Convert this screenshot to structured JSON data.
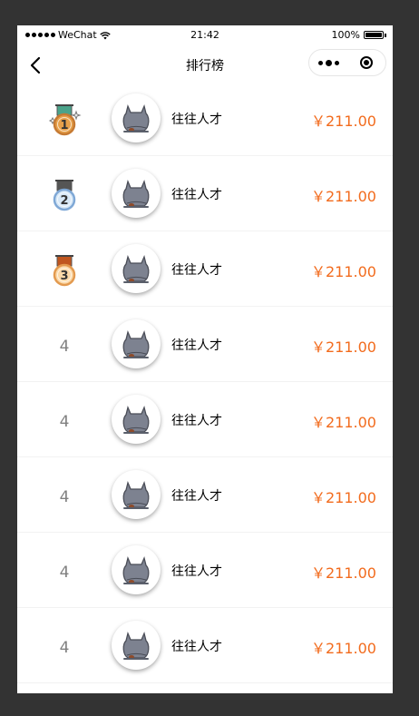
{
  "status_bar": {
    "carrier": "WeChat",
    "time": "21:42",
    "battery_text": "100%"
  },
  "nav": {
    "title": "排行榜"
  },
  "colors": {
    "amount": "#f26b1d",
    "rank_number": "#808080",
    "gold": "#e0913a",
    "silver": "#a9cdee",
    "bronze": "#f6b26b"
  },
  "icons": {
    "back": "chevron-left-icon",
    "gold": "gold-medal-icon",
    "silver": "silver-medal-icon",
    "bronze": "bronze-medal-icon",
    "avatar": "cat-avatar-icon"
  },
  "rankings": [
    {
      "rank_label": "1",
      "medal": "gold",
      "name": "往往人才",
      "amount": "￥211.00"
    },
    {
      "rank_label": "2",
      "medal": "silver",
      "name": "往往人才",
      "amount": "￥211.00"
    },
    {
      "rank_label": "3",
      "medal": "bronze",
      "name": "往往人才",
      "amount": "￥211.00"
    },
    {
      "rank_label": "4",
      "medal": "",
      "name": "往往人才",
      "amount": "￥211.00"
    },
    {
      "rank_label": "4",
      "medal": "",
      "name": "往往人才",
      "amount": "￥211.00"
    },
    {
      "rank_label": "4",
      "medal": "",
      "name": "往往人才",
      "amount": "￥211.00"
    },
    {
      "rank_label": "4",
      "medal": "",
      "name": "往往人才",
      "amount": "￥211.00"
    },
    {
      "rank_label": "4",
      "medal": "",
      "name": "往往人才",
      "amount": "￥211.00"
    }
  ]
}
